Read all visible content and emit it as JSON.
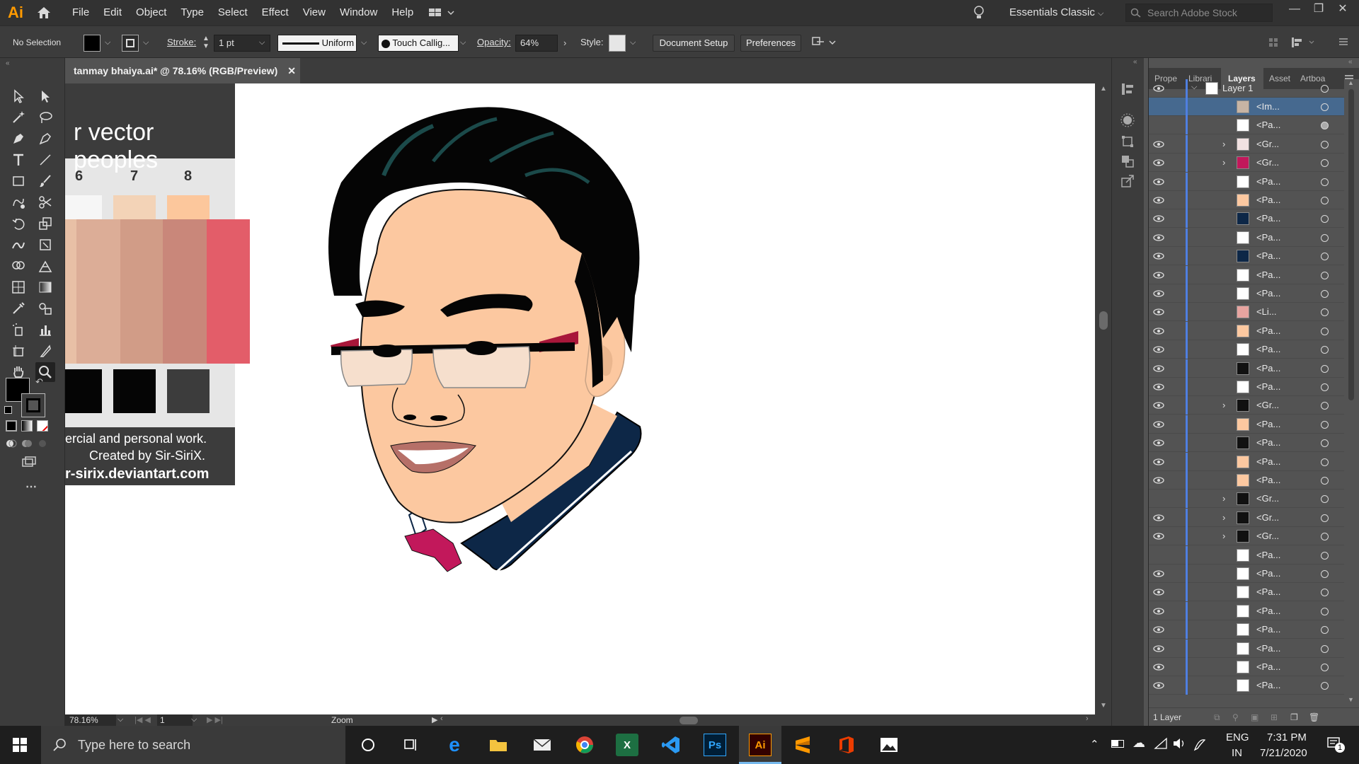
{
  "app": {
    "logo": "Ai",
    "menus": [
      "File",
      "Edit",
      "Object",
      "Type",
      "Select",
      "Effect",
      "View",
      "Window",
      "Help"
    ],
    "workspace": "Essentials Classic",
    "search_placeholder": "Search Adobe Stock"
  },
  "control_bar": {
    "selection": "No Selection",
    "stroke_label": "Stroke:",
    "stroke_value": "1 pt",
    "profile": "Uniform",
    "brush": "Touch Callig...",
    "opacity_label": "Opacity:",
    "opacity_value": "64%",
    "style_label": "Style:",
    "document_setup": "Document Setup",
    "preferences": "Preferences"
  },
  "document_tab": {
    "title": "tanmay bhaiya.ai* @ 78.16% (RGB/Preview)",
    "close": "✕"
  },
  "artwork_text": {
    "heading": "r vector peoples",
    "numbers": [
      "6",
      "7",
      "8"
    ],
    "line1": "ercial and personal work.",
    "line2": "Created by Sir-SiriX.",
    "line3": "r-sirix.deviantart.com"
  },
  "layers_panel": {
    "tabs": [
      "Prope",
      "Librari",
      "Layers",
      "Asset",
      "Artboa"
    ],
    "active_tab": "Layers",
    "layer1": "Layer 1",
    "footer": "1 Layer",
    "rows": [
      {
        "name": "<Im...",
        "eye": false,
        "arrow": false,
        "selected": true,
        "target_filled": false
      },
      {
        "name": "<Pa...",
        "eye": false,
        "arrow": false,
        "selected": false,
        "target_filled": true
      },
      {
        "name": "<Gr...",
        "eye": true,
        "arrow": true,
        "selected": false,
        "target_filled": false
      },
      {
        "name": "<Gr...",
        "eye": true,
        "arrow": true,
        "selected": false,
        "target_filled": false
      },
      {
        "name": "<Pa...",
        "eye": true,
        "arrow": false,
        "selected": false,
        "target_filled": false
      },
      {
        "name": "<Pa...",
        "eye": true,
        "arrow": false,
        "selected": false,
        "target_filled": false
      },
      {
        "name": "<Pa...",
        "eye": true,
        "arrow": false,
        "selected": false,
        "target_filled": false
      },
      {
        "name": "<Pa...",
        "eye": true,
        "arrow": false,
        "selected": false,
        "target_filled": false
      },
      {
        "name": "<Pa...",
        "eye": true,
        "arrow": false,
        "selected": false,
        "target_filled": false
      },
      {
        "name": "<Pa...",
        "eye": true,
        "arrow": false,
        "selected": false,
        "target_filled": false
      },
      {
        "name": "<Pa...",
        "eye": true,
        "arrow": false,
        "selected": false,
        "target_filled": false
      },
      {
        "name": "<Li...",
        "eye": true,
        "arrow": false,
        "selected": false,
        "target_filled": false
      },
      {
        "name": "<Pa...",
        "eye": true,
        "arrow": false,
        "selected": false,
        "target_filled": false
      },
      {
        "name": "<Pa...",
        "eye": true,
        "arrow": false,
        "selected": false,
        "target_filled": false
      },
      {
        "name": "<Pa...",
        "eye": true,
        "arrow": false,
        "selected": false,
        "target_filled": false
      },
      {
        "name": "<Pa...",
        "eye": true,
        "arrow": false,
        "selected": false,
        "target_filled": false
      },
      {
        "name": "<Gr...",
        "eye": true,
        "arrow": true,
        "selected": false,
        "target_filled": false
      },
      {
        "name": "<Pa...",
        "eye": true,
        "arrow": false,
        "selected": false,
        "target_filled": false
      },
      {
        "name": "<Pa...",
        "eye": true,
        "arrow": false,
        "selected": false,
        "target_filled": false
      },
      {
        "name": "<Pa...",
        "eye": true,
        "arrow": false,
        "selected": false,
        "target_filled": false
      },
      {
        "name": "<Pa...",
        "eye": true,
        "arrow": false,
        "selected": false,
        "target_filled": false
      },
      {
        "name": "<Gr...",
        "eye": false,
        "arrow": true,
        "selected": false,
        "target_filled": false
      },
      {
        "name": "<Gr...",
        "eye": true,
        "arrow": true,
        "selected": false,
        "target_filled": false
      },
      {
        "name": "<Gr...",
        "eye": true,
        "arrow": true,
        "selected": false,
        "target_filled": false
      },
      {
        "name": "<Pa...",
        "eye": false,
        "arrow": false,
        "selected": false,
        "target_filled": false
      },
      {
        "name": "<Pa...",
        "eye": true,
        "arrow": false,
        "selected": false,
        "target_filled": false
      },
      {
        "name": "<Pa...",
        "eye": true,
        "arrow": false,
        "selected": false,
        "target_filled": false
      },
      {
        "name": "<Pa...",
        "eye": true,
        "arrow": false,
        "selected": false,
        "target_filled": false
      },
      {
        "name": "<Pa...",
        "eye": true,
        "arrow": false,
        "selected": false,
        "target_filled": false
      },
      {
        "name": "<Pa...",
        "eye": true,
        "arrow": false,
        "selected": false,
        "target_filled": false
      },
      {
        "name": "<Pa...",
        "eye": true,
        "arrow": false,
        "selected": false,
        "target_filled": false
      },
      {
        "name": "<Pa...",
        "eye": true,
        "arrow": false,
        "selected": false,
        "target_filled": false
      }
    ]
  },
  "status_bar": {
    "zoom": "78.16%",
    "artboard": "1",
    "tool": "Zoom"
  },
  "taskbar": {
    "search_placeholder": "Type here to search",
    "lang1": "ENG",
    "lang2": "IN",
    "time": "7:31 PM",
    "date": "7/21/2020",
    "notifications": "1"
  },
  "colors": {
    "accent": "#4f7fe0",
    "ai_orange": "#ff9a00"
  }
}
